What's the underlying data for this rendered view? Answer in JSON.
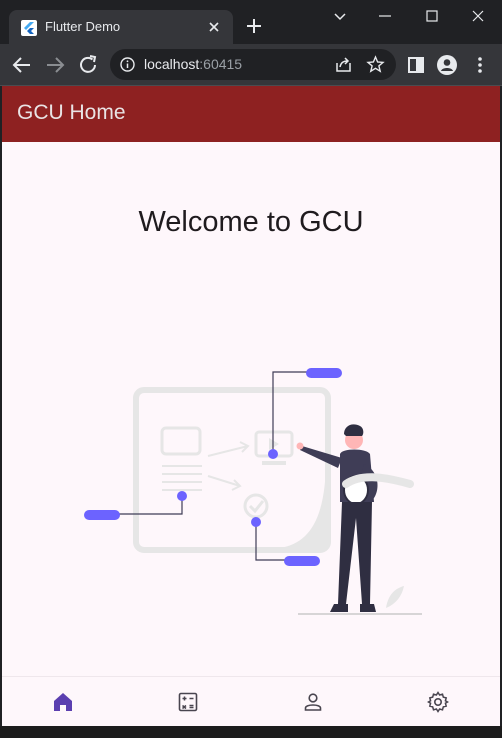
{
  "browser": {
    "tab_title": "Flutter Demo",
    "url_host": "localhost",
    "url_port": ":60415"
  },
  "app": {
    "title": "GCU Home",
    "welcome": "Welcome to GCU"
  },
  "navbar": {
    "items": [
      {
        "icon": "home-icon",
        "active": true
      },
      {
        "icon": "calculator-icon",
        "active": false
      },
      {
        "icon": "person-icon",
        "active": false
      },
      {
        "icon": "gear-icon",
        "active": false
      }
    ]
  },
  "colors": {
    "appbar": "#8e2121",
    "accent": "#6c63ff",
    "nav_active": "#5b3fb0",
    "page_bg": "#fef7fb"
  }
}
